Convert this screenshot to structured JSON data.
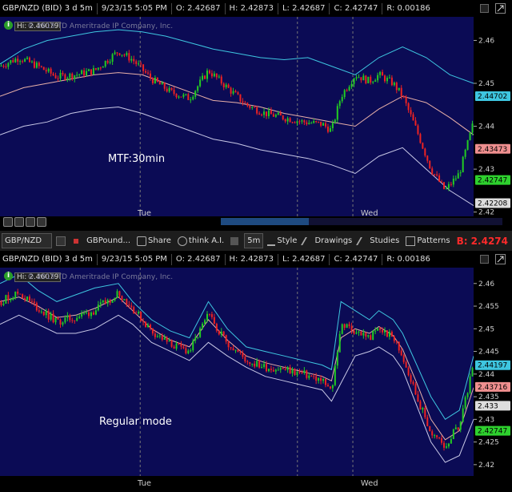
{
  "header": {
    "symbol_desc": "GBP/NZD (BID) 3 d 5m",
    "datetime": "9/23/15 5:05 PM",
    "open": "O: 2.42687",
    "high": "H: 2.42873",
    "low": "L: 2.42687",
    "close": "C: 2.42747",
    "range": "R: 0.00186"
  },
  "watermark": "© 2015 TD Ameritrade IP Company, Inc.",
  "hi_label": "Hi: 2.46079",
  "info_icon": "i",
  "toolbar": {
    "symbol_input": "GBP/NZD",
    "title": "GBPound...",
    "share": "Share",
    "thinkai": "think A.I.",
    "interval": "5m",
    "style": "Style",
    "drawings": "Drawings",
    "studies": "Studies",
    "patterns": "Patterns",
    "bid_price": "B: 2.4274"
  },
  "icons": {
    "info": "info-circle-icon",
    "dropdown": "chevron-down-icon",
    "maximize": "maximize-icon",
    "zoom_in": "zoom-in-icon",
    "zoom_out": "zoom-out-icon",
    "draw": "pencil-icon"
  },
  "colors": {
    "plot_bg": "#0b0b55",
    "upper_band": "#3ec6e0",
    "lower_band": "#c8c8e6",
    "mid_line": "#e8b0a8",
    "candle_up": "#22cc22",
    "candle_down": "#ee2222",
    "last_green": "#2ed12e",
    "bid_red": "#ff2a2a"
  },
  "chart_data": [
    {
      "type": "line",
      "subtitle": "MTF:30min",
      "x_tick_labels": [
        "Tue",
        "Wed"
      ],
      "y_ticks": [
        2.42,
        2.43,
        2.44,
        2.45,
        2.46
      ],
      "ylim": [
        2.419,
        2.4655
      ],
      "price_tags": [
        {
          "label": "2.44702",
          "value": 2.44702,
          "color": "#3ec6e0"
        },
        {
          "label": "2.43473",
          "value": 2.43473,
          "color": "#ef8f8f"
        },
        {
          "label": "2.42747",
          "value": 2.42747,
          "color": "#2ed12e"
        },
        {
          "label": "2.42208",
          "value": 2.42208,
          "color": "#dddddd"
        }
      ],
      "session_markers_x": [
        0.296,
        0.628,
        0.745
      ],
      "series": [
        {
          "role": "upper",
          "points": [
            [
              0,
              2.4545
            ],
            [
              0.05,
              2.458
            ],
            [
              0.1,
              2.46
            ],
            [
              0.15,
              2.461
            ],
            [
              0.2,
              2.462
            ],
            [
              0.25,
              2.4625
            ],
            [
              0.3,
              2.462
            ],
            [
              0.35,
              2.461
            ],
            [
              0.4,
              2.4595
            ],
            [
              0.45,
              2.458
            ],
            [
              0.5,
              2.457
            ],
            [
              0.55,
              2.456
            ],
            [
              0.6,
              2.4555
            ],
            [
              0.65,
              2.456
            ],
            [
              0.7,
              2.454
            ],
            [
              0.75,
              2.452
            ],
            [
              0.8,
              2.456
            ],
            [
              0.85,
              2.4585
            ],
            [
              0.9,
              2.456
            ],
            [
              0.95,
              2.452
            ],
            [
              1.0,
              2.45
            ]
          ]
        },
        {
          "role": "mid",
          "points": [
            [
              0,
              2.447
            ],
            [
              0.05,
              2.449
            ],
            [
              0.1,
              2.45
            ],
            [
              0.15,
              2.451
            ],
            [
              0.2,
              2.452
            ],
            [
              0.25,
              2.4525
            ],
            [
              0.3,
              2.452
            ],
            [
              0.35,
              2.45
            ],
            [
              0.4,
              2.448
            ],
            [
              0.45,
              2.446
            ],
            [
              0.5,
              2.4455
            ],
            [
              0.55,
              2.4445
            ],
            [
              0.6,
              2.443
            ],
            [
              0.65,
              2.442
            ],
            [
              0.7,
              2.441
            ],
            [
              0.75,
              2.44
            ],
            [
              0.8,
              2.444
            ],
            [
              0.85,
              2.447
            ],
            [
              0.9,
              2.4455
            ],
            [
              0.95,
              2.442
            ],
            [
              1.0,
              2.438
            ]
          ]
        },
        {
          "role": "lower",
          "points": [
            [
              0,
              2.438
            ],
            [
              0.05,
              2.44
            ],
            [
              0.1,
              2.441
            ],
            [
              0.15,
              2.443
            ],
            [
              0.2,
              2.444
            ],
            [
              0.25,
              2.4445
            ],
            [
              0.3,
              2.443
            ],
            [
              0.35,
              2.441
            ],
            [
              0.4,
              2.439
            ],
            [
              0.45,
              2.437
            ],
            [
              0.5,
              2.436
            ],
            [
              0.55,
              2.4345
            ],
            [
              0.6,
              2.4335
            ],
            [
              0.65,
              2.4325
            ],
            [
              0.7,
              2.431
            ],
            [
              0.75,
              2.429
            ],
            [
              0.8,
              2.433
            ],
            [
              0.85,
              2.435
            ],
            [
              0.9,
              2.43
            ],
            [
              0.95,
              2.425
            ],
            [
              1.0,
              2.4215
            ]
          ]
        },
        {
          "role": "price",
          "points": [
            [
              0,
              2.454
            ],
            [
              0.04,
              2.456
            ],
            [
              0.08,
              2.454
            ],
            [
              0.12,
              2.4515
            ],
            [
              0.16,
              2.452
            ],
            [
              0.2,
              2.453
            ],
            [
              0.25,
              2.4575
            ],
            [
              0.28,
              2.4555
            ],
            [
              0.32,
              2.451
            ],
            [
              0.36,
              2.448
            ],
            [
              0.4,
              2.4465
            ],
            [
              0.44,
              2.453
            ],
            [
              0.48,
              2.449
            ],
            [
              0.52,
              2.445
            ],
            [
              0.56,
              2.443
            ],
            [
              0.6,
              2.442
            ],
            [
              0.64,
              2.441
            ],
            [
              0.68,
              2.4405
            ],
            [
              0.7,
              2.439
            ],
            [
              0.72,
              2.447
            ],
            [
              0.75,
              2.452
            ],
            [
              0.78,
              2.4505
            ],
            [
              0.8,
              2.452
            ],
            [
              0.83,
              2.45
            ],
            [
              0.85,
              2.447
            ],
            [
              0.88,
              2.439
            ],
            [
              0.91,
              2.43
            ],
            [
              0.94,
              2.425
            ],
            [
              0.97,
              2.429
            ],
            [
              1.0,
              2.441
            ]
          ]
        }
      ]
    },
    {
      "type": "line",
      "subtitle": "Regular mode",
      "x_tick_labels": [
        "Tue",
        "Wed"
      ],
      "y_ticks": [
        2.42,
        2.425,
        2.43,
        2.435,
        2.44,
        2.445,
        2.45,
        2.455,
        2.46
      ],
      "ylim": [
        2.4175,
        2.4635
      ],
      "price_tags": [
        {
          "label": "2.44197",
          "value": 2.44197,
          "color": "#3ec6e0"
        },
        {
          "label": "2.43716",
          "value": 2.43716,
          "color": "#ef8f8f"
        },
        {
          "label": "2.433",
          "value": 2.433,
          "color": "#dddddd"
        },
        {
          "label": "2.42747",
          "value": 2.42747,
          "color": "#2ed12e"
        }
      ],
      "session_markers_x": [
        0.296,
        0.628,
        0.745
      ],
      "series": [
        {
          "role": "upper",
          "points": [
            [
              0,
              2.46
            ],
            [
              0.04,
              2.462
            ],
            [
              0.08,
              2.4585
            ],
            [
              0.12,
              2.456
            ],
            [
              0.16,
              2.4575
            ],
            [
              0.2,
              2.459
            ],
            [
              0.25,
              2.46
            ],
            [
              0.28,
              2.456
            ],
            [
              0.32,
              2.452
            ],
            [
              0.36,
              2.4495
            ],
            [
              0.4,
              2.448
            ],
            [
              0.44,
              2.456
            ],
            [
              0.48,
              2.45
            ],
            [
              0.52,
              2.446
            ],
            [
              0.56,
              2.445
            ],
            [
              0.6,
              2.444
            ],
            [
              0.64,
              2.443
            ],
            [
              0.68,
              2.442
            ],
            [
              0.7,
              2.441
            ],
            [
              0.72,
              2.456
            ],
            [
              0.75,
              2.454
            ],
            [
              0.78,
              2.452
            ],
            [
              0.8,
              2.454
            ],
            [
              0.83,
              2.452
            ],
            [
              0.85,
              2.449
            ],
            [
              0.88,
              2.442
            ],
            [
              0.91,
              2.435
            ],
            [
              0.94,
              2.43
            ],
            [
              0.97,
              2.432
            ],
            [
              1.0,
              2.444
            ]
          ]
        },
        {
          "role": "mid",
          "points": [
            [
              0,
              2.456
            ],
            [
              0.04,
              2.457
            ],
            [
              0.08,
              2.455
            ],
            [
              0.12,
              2.4525
            ],
            [
              0.16,
              2.453
            ],
            [
              0.2,
              2.4545
            ],
            [
              0.25,
              2.457
            ],
            [
              0.28,
              2.454
            ],
            [
              0.32,
              2.45
            ],
            [
              0.36,
              2.4475
            ],
            [
              0.4,
              2.446
            ],
            [
              0.44,
              2.452
            ],
            [
              0.48,
              2.4475
            ],
            [
              0.52,
              2.444
            ],
            [
              0.56,
              2.4425
            ],
            [
              0.6,
              2.4415
            ],
            [
              0.64,
              2.4405
            ],
            [
              0.68,
              2.4395
            ],
            [
              0.7,
              2.4385
            ],
            [
              0.72,
              2.448
            ],
            [
              0.75,
              2.45
            ],
            [
              0.78,
              2.449
            ],
            [
              0.8,
              2.4505
            ],
            [
              0.83,
              2.4485
            ],
            [
              0.85,
              2.4455
            ],
            [
              0.88,
              2.438
            ],
            [
              0.91,
              2.43
            ],
            [
              0.94,
              2.4255
            ],
            [
              0.97,
              2.4275
            ],
            [
              1.0,
              2.437
            ]
          ]
        },
        {
          "role": "lower",
          "points": [
            [
              0,
              2.451
            ],
            [
              0.04,
              2.453
            ],
            [
              0.08,
              2.451
            ],
            [
              0.12,
              2.449
            ],
            [
              0.16,
              2.449
            ],
            [
              0.2,
              2.45
            ],
            [
              0.25,
              2.453
            ],
            [
              0.28,
              2.451
            ],
            [
              0.32,
              2.447
            ],
            [
              0.36,
              2.445
            ],
            [
              0.4,
              2.443
            ],
            [
              0.44,
              2.447
            ],
            [
              0.48,
              2.444
            ],
            [
              0.52,
              2.4415
            ],
            [
              0.56,
              2.4395
            ],
            [
              0.6,
              2.4385
            ],
            [
              0.64,
              2.4375
            ],
            [
              0.68,
              2.4365
            ],
            [
              0.7,
              2.434
            ],
            [
              0.72,
              2.438
            ],
            [
              0.75,
              2.444
            ],
            [
              0.78,
              2.445
            ],
            [
              0.8,
              2.446
            ],
            [
              0.83,
              2.444
            ],
            [
              0.85,
              2.441
            ],
            [
              0.88,
              2.433
            ],
            [
              0.91,
              2.425
            ],
            [
              0.94,
              2.4205
            ],
            [
              0.97,
              2.422
            ],
            [
              1.0,
              2.43
            ]
          ]
        },
        {
          "role": "price",
          "points": [
            [
              0,
              2.456
            ],
            [
              0.04,
              2.458
            ],
            [
              0.08,
              2.4545
            ],
            [
              0.12,
              2.4515
            ],
            [
              0.16,
              2.4525
            ],
            [
              0.2,
              2.454
            ],
            [
              0.25,
              2.458
            ],
            [
              0.28,
              2.4545
            ],
            [
              0.32,
              2.4495
            ],
            [
              0.36,
              2.4465
            ],
            [
              0.4,
              2.445
            ],
            [
              0.44,
              2.453
            ],
            [
              0.48,
              2.447
            ],
            [
              0.52,
              2.443
            ],
            [
              0.56,
              2.4415
            ],
            [
              0.6,
              2.441
            ],
            [
              0.64,
              2.44
            ],
            [
              0.68,
              2.4385
            ],
            [
              0.7,
              2.436
            ],
            [
              0.72,
              2.451
            ],
            [
              0.75,
              2.4495
            ],
            [
              0.78,
              2.448
            ],
            [
              0.8,
              2.45
            ],
            [
              0.83,
              2.448
            ],
            [
              0.85,
              2.444
            ],
            [
              0.88,
              2.435
            ],
            [
              0.91,
              2.427
            ],
            [
              0.94,
              2.424
            ],
            [
              0.97,
              2.429
            ],
            [
              1.0,
              2.442
            ]
          ]
        }
      ]
    }
  ]
}
